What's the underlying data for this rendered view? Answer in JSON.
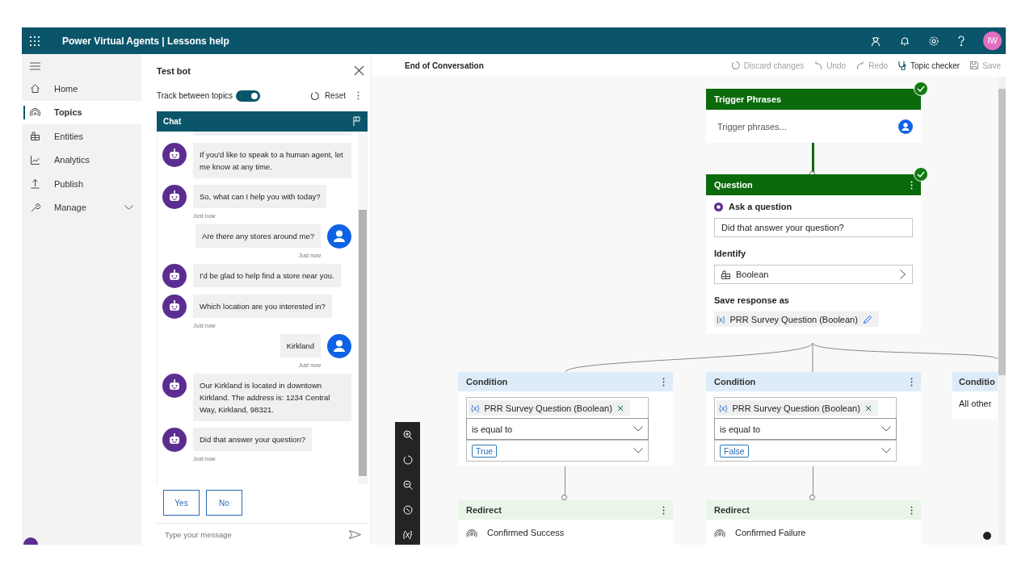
{
  "app_bar": {
    "title": "Power Virtual Agents | Lessons help",
    "avatar_initials": "IW"
  },
  "sidebar": {
    "items": [
      {
        "label": "Home",
        "selected": false,
        "expandable": false
      },
      {
        "label": "Topics",
        "selected": true,
        "expandable": false
      },
      {
        "label": "Entities",
        "selected": false,
        "expandable": false
      },
      {
        "label": "Analytics",
        "selected": false,
        "expandable": false
      },
      {
        "label": "Publish",
        "selected": false,
        "expandable": false
      },
      {
        "label": "Manage",
        "selected": false,
        "expandable": true
      }
    ]
  },
  "test_bot": {
    "title": "Test bot",
    "track_label": "Track between topics",
    "track_on": true,
    "reset_label": "Reset",
    "chat_title": "Chat",
    "messages": [
      {
        "kind": "bot",
        "text": "If you'd like to speak to a human agent, let me know at any time."
      },
      {
        "kind": "bot",
        "text": "So, what can I help you with today?",
        "time": "Just now"
      },
      {
        "kind": "user",
        "text": "Are there any stores around me?",
        "time": "Just now"
      },
      {
        "kind": "bot",
        "text": "I'd be glad to help find a store near you."
      },
      {
        "kind": "bot",
        "text": "Which location are you interested in?",
        "time": "Just now"
      },
      {
        "kind": "user",
        "text": "Kirkland",
        "time": "Just now"
      },
      {
        "kind": "bot",
        "text": "Our Kirkland is located in downtown Kirkland. The address is: 1234 Central Way, Kirkland, 98321."
      },
      {
        "kind": "bot",
        "text": "Did that answer your question?",
        "time": "Just now"
      }
    ],
    "quick_replies": [
      "Yes",
      "No"
    ],
    "input": {
      "placeholder": "Type your message"
    }
  },
  "canvas": {
    "topic_title": "End of Conversation",
    "toolbar": [
      {
        "kind": "discard",
        "label": "Discard changes",
        "disabled": true
      },
      {
        "kind": "undo",
        "label": "Undo",
        "disabled": true
      },
      {
        "kind": "redo",
        "label": "Redo",
        "disabled": true
      },
      {
        "kind": "checker",
        "label": "Topic checker",
        "disabled": false
      },
      {
        "kind": "save",
        "label": "Save",
        "disabled": true
      }
    ],
    "trigger": {
      "title": "Trigger Phrases",
      "placeholder": "Trigger phrases...",
      "checked": true
    },
    "question": {
      "title": "Question",
      "checked": true,
      "prompt_label": "Ask a question",
      "prompt_value": "Did that answer your question?",
      "identify_label": "Identify",
      "identify_value": "Boolean",
      "save_label": "Save response as",
      "variable_icon": "{x}",
      "variable": "PRR Survey Question (Boolean)"
    },
    "conditions": [
      {
        "title": "Condition",
        "variable_icon": "{x}",
        "variable": "PRR Survey Question (Boolean)",
        "operator": "is equal to",
        "value": "True",
        "redirect": {
          "title": "Redirect",
          "target": "Confirmed Success"
        }
      },
      {
        "title": "Condition",
        "variable_icon": "{x}",
        "variable": "PRR Survey Question (Boolean)",
        "operator": "is equal to",
        "value": "False",
        "redirect": {
          "title": "Redirect",
          "target": "Confirmed Failure"
        }
      }
    ],
    "other_condition": {
      "title": "Conditio",
      "text": "All other"
    },
    "tools": [
      {
        "kind": "zoom-in"
      },
      {
        "kind": "reset"
      },
      {
        "kind": "zoom-out"
      },
      {
        "kind": "fit"
      },
      {
        "kind": "variables",
        "label": "{x}"
      }
    ]
  }
}
